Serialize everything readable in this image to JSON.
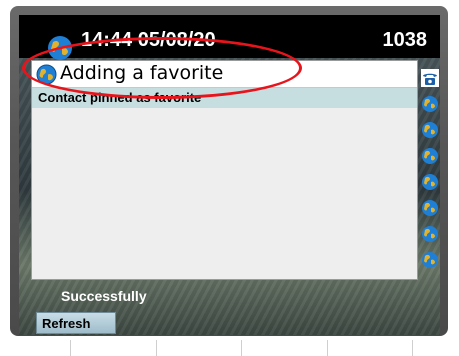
{
  "status_bar": {
    "time_date": "14:44 05/08/20",
    "extension": "1038"
  },
  "dialog": {
    "title": "Adding a favorite",
    "message": "Contact pinned as favorite"
  },
  "side_lines": [
    {
      "icon": "phone-handset-icon"
    },
    {
      "icon": "globe-icon"
    },
    {
      "icon": "globe-icon"
    },
    {
      "icon": "globe-icon"
    },
    {
      "icon": "globe-icon"
    },
    {
      "icon": "globe-icon"
    },
    {
      "icon": "globe-icon"
    },
    {
      "icon": "globe-icon"
    }
  ],
  "status_message": "Successfully",
  "softkeys": {
    "refresh_label": "Refresh"
  },
  "colors": {
    "status_bar": "#000000",
    "message_band": "#c7dee0",
    "annotation": "#e8141c"
  }
}
